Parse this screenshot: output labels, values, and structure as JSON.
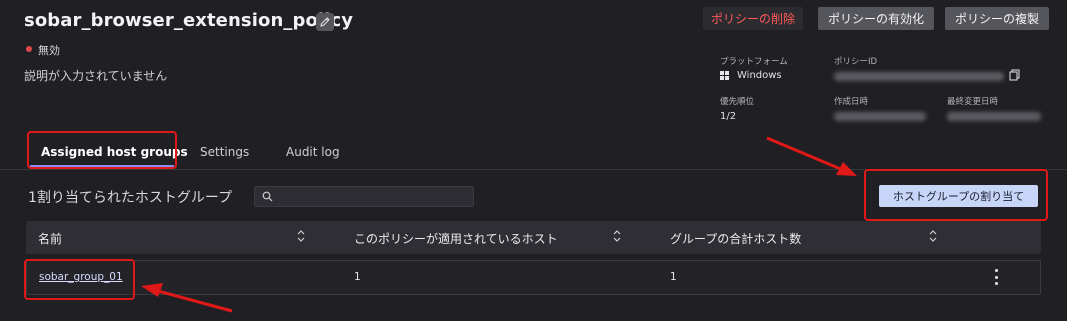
{
  "policy": {
    "name": "sobar_browser_extension_policy",
    "status": "無効",
    "status_color": "#e0494c",
    "description": "説明が入力されていません"
  },
  "actions": {
    "delete": "ポリシーの削除",
    "enable": "ポリシーの有効化",
    "duplicate": "ポリシーの複製"
  },
  "meta": {
    "platform_label": "プラットフォーム",
    "platform_value": "Windows",
    "policy_id_label": "ポリシーID",
    "priority_label": "優先順位",
    "priority_value": "1/2",
    "created_label": "作成日時",
    "modified_label": "最終変更日時"
  },
  "tabs": [
    {
      "label": "Assigned host groups",
      "active": true
    },
    {
      "label": "Settings",
      "active": false
    },
    {
      "label": "Audit log",
      "active": false
    }
  ],
  "section": {
    "title": "1割り当てられたホストグループ",
    "search_placeholder": "",
    "assign_button": "ホストグループの割り当て"
  },
  "table": {
    "columns": [
      "名前",
      "このポリシーが適用されているホスト",
      "グループの合計ホスト数"
    ],
    "rows": [
      {
        "name": "sobar_group_01",
        "applied_hosts": "1",
        "total_hosts": "1"
      }
    ]
  },
  "colors": {
    "accent": "#8a8cf0",
    "danger": "#ff5a5a",
    "annotation": "#e01818"
  }
}
